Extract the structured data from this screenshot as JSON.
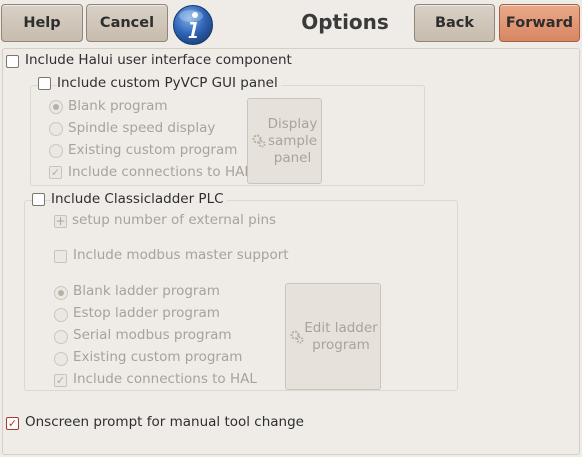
{
  "header": {
    "help_label": "Help",
    "cancel_label": "Cancel",
    "title": "Options",
    "back_label": "Back",
    "forward_label": "Forward"
  },
  "options": {
    "halui_label": "Include Halui user interface component",
    "pyvcp": {
      "label": "Include custom PyVCP GUI panel",
      "blank": "Blank program",
      "spindle": "Spindle speed display",
      "existing": "Existing custom program",
      "connections": "Include connections to HAL",
      "display_btn": "Display\nsample\npanel"
    },
    "classicladder": {
      "label": "Include Classicladder PLC",
      "pins": "setup number of external pins",
      "modbus": "Include modbus master support",
      "blank": "Blank ladder program",
      "estop": "Estop ladder program",
      "serial": "Serial modbus program",
      "existing": "Existing custom program",
      "connections": "Include connections to HAL",
      "edit_btn": "Edit ladder\nprogram"
    },
    "toolchange_label": "Onscreen prompt for manual tool change"
  },
  "colors": {
    "window_bg": "#efebe7",
    "accent": "#d98662",
    "info_blue": "#2e63b5",
    "check_red": "#c0392b"
  }
}
